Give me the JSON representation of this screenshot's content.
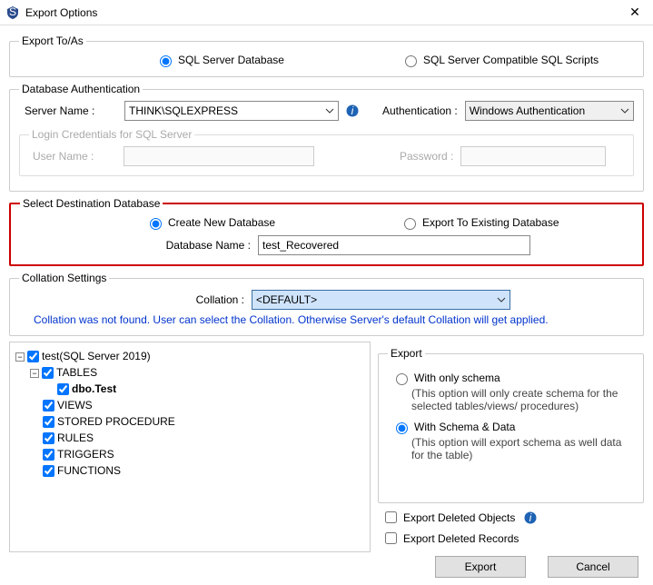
{
  "titlebar": {
    "title": "Export Options"
  },
  "exportTo": {
    "legend": "Export To/As",
    "opt1": "SQL Server Database",
    "opt2": "SQL Server Compatible SQL Scripts"
  },
  "auth": {
    "legend": "Database Authentication",
    "serverNameLabel": "Server Name :",
    "serverName": "THINK\\SQLEXPRESS",
    "authLabel": "Authentication :",
    "authValue": "Windows Authentication",
    "login": {
      "legend": "Login Credentials for SQL Server",
      "userLabel": "User Name :",
      "passLabel": "Password :"
    }
  },
  "dest": {
    "legend": "Select Destination Database",
    "opt1": "Create New Database",
    "opt2": "Export To Existing Database",
    "dbNameLabel": "Database Name :",
    "dbName": "test_Recovered"
  },
  "collation": {
    "legend": "Collation Settings",
    "label": "Collation :",
    "value": "<DEFAULT>",
    "note": "Collation was not found. User can select the Collation. Otherwise Server's default Collation will get applied."
  },
  "tree": {
    "root": "test(SQL Server 2019)",
    "tables": "TABLES",
    "dboTest": "dbo.Test",
    "views": "VIEWS",
    "sp": "STORED PROCEDURE",
    "rules": "RULES",
    "triggers": "TRIGGERS",
    "functions": "FUNCTIONS"
  },
  "export": {
    "legend": "Export",
    "schemaOnly": "With only schema",
    "schemaOnlyDesc": "(This option will only create schema for the  selected tables/views/ procedures)",
    "schemaData": "With Schema & Data",
    "schemaDataDesc": "(This option will export schema as well data for the table)",
    "delObjects": "Export Deleted Objects",
    "delRecords": "Export Deleted Records"
  },
  "buttons": {
    "export": "Export",
    "cancel": "Cancel"
  }
}
